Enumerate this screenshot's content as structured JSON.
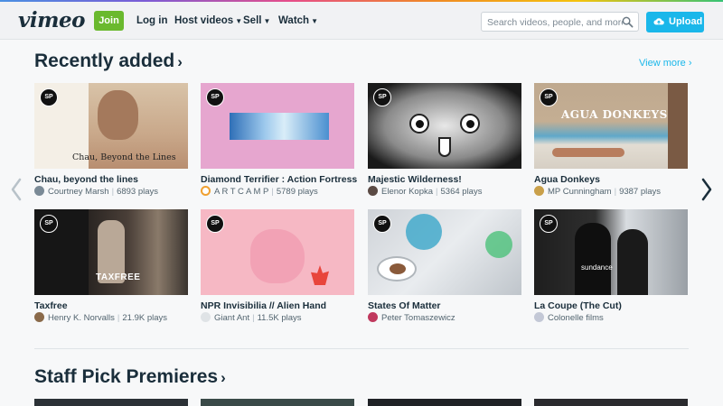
{
  "header": {
    "logo": "vimeo",
    "join_label": "Join",
    "nav": [
      "Log in",
      "Host videos",
      "Sell",
      "Watch"
    ],
    "search_placeholder": "Search videos, people, and more",
    "upload_label": "Upload"
  },
  "recently_added": {
    "title": "Recently added",
    "view_more": "View more",
    "items": [
      {
        "title": "Chau, beyond the lines",
        "author": "Courtney Marsh",
        "plays": "6893 plays",
        "overlay": "Chau, Beyond the Lines"
      },
      {
        "title": "Diamond Terrifier : Action Fortress",
        "author": "A R T C A M P",
        "plays": "5789 plays"
      },
      {
        "title": "Majestic Wilderness!",
        "author": "Elenor Kopka",
        "plays": "5364 plays"
      },
      {
        "title": "Agua Donkeys",
        "author": "MP Cunningham",
        "plays": "9387 plays",
        "overlay": "AGUA DONKEYS"
      },
      {
        "title": "Taxfree",
        "author": "Henry K. Norvalls",
        "plays": "21.9K plays",
        "overlay": "TAXFREE"
      },
      {
        "title": "NPR Invisibilia // Alien Hand",
        "author": "Giant Ant",
        "plays": "11.5K plays"
      },
      {
        "title": "States Of Matter",
        "author": "Peter Tomaszewicz",
        "plays": ""
      },
      {
        "title": "La Coupe (The Cut)",
        "author": "Colonelle films",
        "plays": "",
        "overlay": "sundance"
      }
    ]
  },
  "staff_picks": {
    "title": "Staff Pick Premieres"
  },
  "icons": {
    "staff_pick_badge": "SP",
    "search": "search-icon",
    "upload": "upload-cloud-icon",
    "prev": "chevron-left-icon",
    "next": "chevron-right-icon"
  },
  "colors": {
    "accent": "#1ab7ea",
    "join": "#6ab92e",
    "text": "#1a2e3b"
  }
}
